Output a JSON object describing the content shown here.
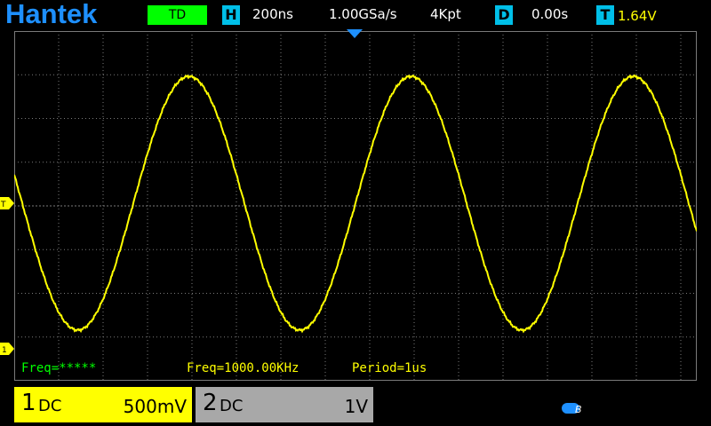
{
  "header": {
    "brand": "Hantek",
    "mode": "TD",
    "horizontal_tag": "H",
    "timebase": "200ns",
    "sample_rate": "1.00GSa/s",
    "memory_depth": "4Kpt",
    "delay_tag": "D",
    "delay": "0.00s",
    "trigger_tag": "T",
    "trigger_level": "1.64V"
  },
  "markers": {
    "trigger_marker": "T",
    "channel1_marker": "1"
  },
  "measurements": {
    "freq_counter": "Freq=*****",
    "ch1_freq": "Freq=1000.00KHz",
    "ch1_period": "Period=1us"
  },
  "channels": [
    {
      "number": "1",
      "coupling": "DC",
      "scale": "500mV",
      "color": "#ffff00"
    },
    {
      "number": "2",
      "coupling": "DC",
      "scale": "1V",
      "color": "#a8a8a8"
    }
  ],
  "colors": {
    "brand": "#1e90ff",
    "waveform": "#ffff00",
    "grid": "#7a7a7a",
    "counter": "#00ff00",
    "tag": "#00bfe8"
  },
  "chart_data": {
    "type": "line",
    "series": [
      {
        "name": "CH1",
        "frequency_hz": 1000000,
        "period_s": 1e-06
      }
    ],
    "x_div": "200ns",
    "y_div": "500mV",
    "grid": true
  }
}
